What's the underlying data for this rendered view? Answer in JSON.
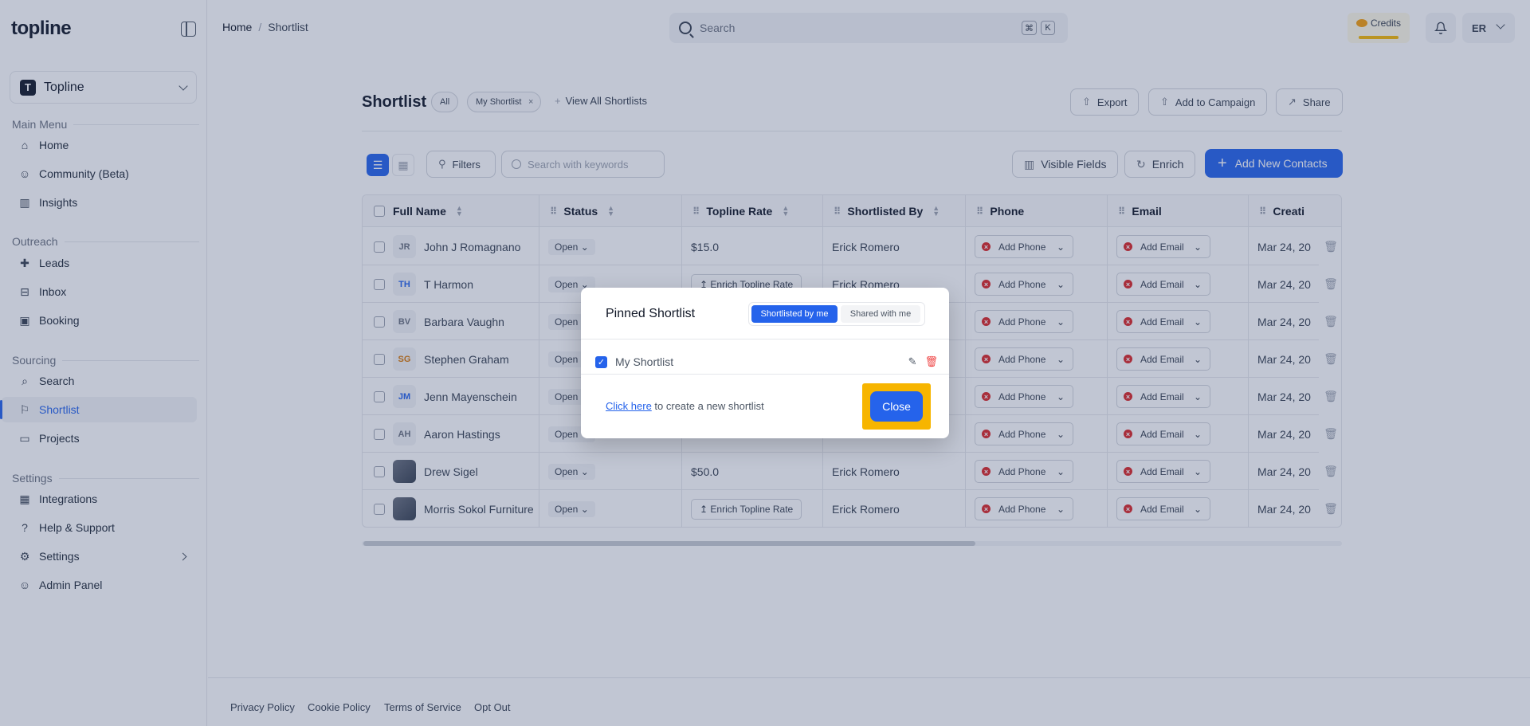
{
  "app": {
    "logo": "topline"
  },
  "sidebar": {
    "workspace": {
      "badge": "T",
      "name": "Topline"
    },
    "sections": [
      {
        "label": "Main Menu",
        "items": [
          {
            "label": "Home",
            "icon": "home-icon"
          },
          {
            "label": "Community (Beta)",
            "icon": "users-icon"
          },
          {
            "label": "Insights",
            "icon": "chart-icon"
          }
        ]
      },
      {
        "label": "Outreach",
        "items": [
          {
            "label": "Leads",
            "icon": "user-plus-icon"
          },
          {
            "label": "Inbox",
            "icon": "inbox-icon"
          },
          {
            "label": "Booking",
            "icon": "calendar-icon"
          }
        ]
      },
      {
        "label": "Sourcing",
        "items": [
          {
            "label": "Search",
            "icon": "search-icon"
          },
          {
            "label": "Shortlist",
            "icon": "bookmark-icon",
            "active": true
          },
          {
            "label": "Projects",
            "icon": "folder-icon"
          }
        ]
      },
      {
        "label": "Settings",
        "items": [
          {
            "label": "Integrations",
            "icon": "grid-icon"
          },
          {
            "label": "Help & Support",
            "icon": "help-icon"
          },
          {
            "label": "Settings",
            "icon": "gear-icon"
          },
          {
            "label": "Admin Panel",
            "icon": "users-icon"
          }
        ]
      }
    ]
  },
  "topbar": {
    "breadcrumb": [
      "Home",
      "Shortlist"
    ],
    "search_placeholder": "Search",
    "kbd": [
      "⌘",
      "K"
    ],
    "credits_label": "Credits",
    "user_initials": "ER"
  },
  "header": {
    "title": "Shortlist",
    "pills": [
      "All",
      "My Shortlist"
    ],
    "view_all": "View All Shortlists",
    "actions": [
      "Export",
      "Add to Campaign",
      "Share"
    ]
  },
  "toolbar": {
    "filters": "Filters",
    "keyword_placeholder": "Search with keywords",
    "visible_fields": "Visible Fields",
    "enrich": "Enrich",
    "add_contacts": "Add New Contacts"
  },
  "table": {
    "columns": [
      "Full Name",
      "Status",
      "Topline Rate",
      "Shortlisted By",
      "Phone",
      "Email",
      "Creati"
    ],
    "rows": [
      {
        "initials": "JR",
        "avatar_color": "#6b7280",
        "name": "John J Romagnano",
        "status": "Open",
        "rate": "$15.0",
        "rate_is_button": false,
        "by": "Erick Romero",
        "phone": "Add Phone",
        "email": "Add Email",
        "created": "Mar 24, 20"
      },
      {
        "initials": "TH",
        "avatar_color": "#2563eb",
        "name": "T Harmon",
        "status": "Open",
        "rate": "Enrich Topline Rate",
        "rate_is_button": true,
        "by": "Erick Romero",
        "phone": "Add Phone",
        "email": "Add Email",
        "created": "Mar 24, 20"
      },
      {
        "initials": "BV",
        "avatar_color": "#6b7280",
        "name": "Barbara Vaughn",
        "status": "Open",
        "rate": "",
        "rate_is_button": false,
        "by": "",
        "phone": "Add Phone",
        "email": "Add Email",
        "created": "Mar 24, 20"
      },
      {
        "initials": "SG",
        "avatar_color": "#d97706",
        "name": "Stephen Graham",
        "status": "Open",
        "rate": "",
        "rate_is_button": false,
        "by": "",
        "phone": "Add Phone",
        "email": "Add Email",
        "created": "Mar 24, 20"
      },
      {
        "initials": "JM",
        "avatar_color": "#2563eb",
        "name": "Jenn Mayenschein",
        "status": "Open",
        "rate": "",
        "rate_is_button": false,
        "by": "",
        "phone": "Add Phone",
        "email": "Add Email",
        "created": "Mar 24, 20"
      },
      {
        "initials": "AH",
        "avatar_color": "#6b7280",
        "name": "Aaron Hastings",
        "status": "Open",
        "rate": "",
        "rate_is_button": false,
        "by": "",
        "phone": "Add Phone",
        "email": "Add Email",
        "created": "Mar 24, 20"
      },
      {
        "initials": "",
        "avatar_color": "#6b7280",
        "name": "Drew Sigel",
        "status": "Open",
        "rate": "$50.0",
        "rate_is_button": false,
        "by": "Erick Romero",
        "phone": "Add Phone",
        "email": "Add Email",
        "created": "Mar 24, 20",
        "photo": true
      },
      {
        "initials": "",
        "avatar_color": "#6b7280",
        "name": "Morris Sokol Furniture",
        "status": "Open",
        "rate": "Enrich Topline Rate",
        "rate_is_button": true,
        "by": "Erick Romero",
        "phone": "Add Phone",
        "email": "Add Email",
        "created": "Mar 24, 20",
        "photo": true
      }
    ]
  },
  "footer": {
    "links": [
      "Privacy Policy",
      "Cookie Policy",
      "Terms of Service",
      "Opt Out"
    ]
  },
  "modal": {
    "title": "Pinned Shortlist",
    "tabs": [
      "Shortlisted by me",
      "Shared with me"
    ],
    "item": "My Shortlist",
    "link_text": "Click here",
    "create_text": " to create a new shortlist",
    "close": "Close"
  }
}
